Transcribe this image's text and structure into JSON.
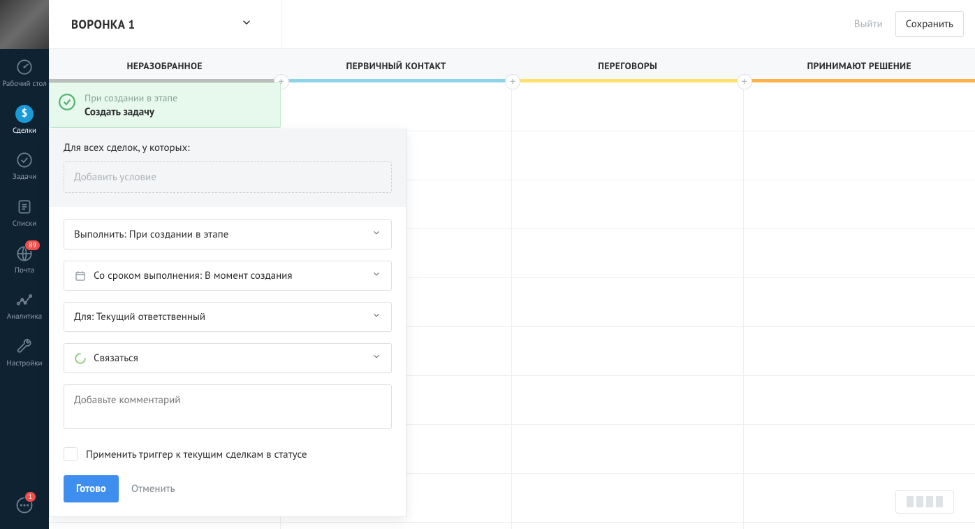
{
  "sidebar": {
    "items": [
      {
        "label": "Рабочий стол"
      },
      {
        "label": "Сделки"
      },
      {
        "label": "Задачи"
      },
      {
        "label": "Списки"
      },
      {
        "label": "Почта",
        "badge": "89"
      },
      {
        "label": "Аналитика"
      },
      {
        "label": "Настройки"
      }
    ],
    "chat_badge": "1"
  },
  "header": {
    "pipeline_title": "ВОРОНКА 1",
    "exit_label": "Выйти",
    "save_label": "Сохранить"
  },
  "stages": [
    {
      "name": "НЕРАЗОБРАННОЕ",
      "color": "#bdbdbd"
    },
    {
      "name": "ПЕРВИЧНЫЙ КОНТАКТ",
      "color": "#8fd3e8"
    },
    {
      "name": "ПЕРЕГОВОРЫ",
      "color": "#ffe06b"
    },
    {
      "name": "ПРИНИМАЮТ РЕШЕНИЕ",
      "color": "#ffb24a"
    }
  ],
  "trigger_card": {
    "line1": "При создании в этапе",
    "line2": "Создать задачу"
  },
  "popup": {
    "for_label": "Для всех сделок, у которых:",
    "condition_placeholder": "Добавить условие",
    "execute_select": "Выполнить: При создании в этапе",
    "deadline_select": "Со сроком выполнения: В момент создания",
    "assignee_select": "Для: Текущий ответственный",
    "action_select": "Связаться",
    "comment_placeholder": "Добавьте комментарий",
    "apply_checkbox_label": "Применить триггер к текущим сделкам в статусе",
    "done_label": "Готово",
    "cancel_label": "Отменить"
  }
}
